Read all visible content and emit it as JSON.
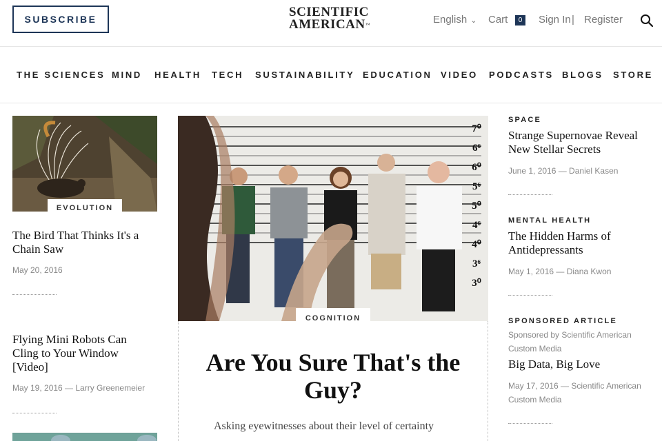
{
  "header": {
    "subscribe_label": "SUBSCRIBE",
    "logo_line1": "SCIENTIFIC",
    "logo_line2": "AMERICAN",
    "logo_tm": "™",
    "language": "English",
    "cart_label": "Cart",
    "cart_count": "0",
    "sign_in": "Sign In",
    "separator": "|",
    "register": "Register",
    "accent_color": "#1d3557"
  },
  "nav": {
    "items": [
      "THE SCIENCES",
      "MIND",
      "HEALTH",
      "TECH",
      "SUSTAINABILITY",
      "EDUCATION",
      "VIDEO",
      "PODCASTS",
      "BLOGS",
      "STORE"
    ]
  },
  "left": {
    "article1": {
      "tag": "EVOLUTION",
      "title": "The Bird That Thinks It's a Chain Saw",
      "date": "May 20, 2016"
    },
    "article2": {
      "title": "Flying Mini Robots Can Cling to Your Window [Video]",
      "meta": "May 19, 2016 — Larry Greenemeier"
    }
  },
  "feature": {
    "tag": "COGNITION",
    "title": "Are You Sure That's the Guy?",
    "dek": "Asking eyewitnesses about their level of certainty",
    "height_marks": [
      "7⁰",
      "6⁶",
      "6⁰",
      "5⁶",
      "5⁰",
      "4⁶",
      "4⁰",
      "3⁶",
      "3⁰"
    ]
  },
  "right": {
    "items": [
      {
        "kicker": "SPACE",
        "title": "Strange Supernovae Reveal New Stellar Secrets",
        "meta": "June 1, 2016 — Daniel Kasen"
      },
      {
        "kicker": "MENTAL HEALTH",
        "title": "The Hidden Harms of Antidepressants",
        "meta": "May 1, 2016 — Diana Kwon"
      },
      {
        "kicker": "SPONSORED ARTICLE",
        "sponsor": "Sponsored by Scientific American Custom Media",
        "title": "Big Data, Big Love",
        "meta": "May 17, 2016 — Scientific American Custom Media"
      }
    ]
  }
}
